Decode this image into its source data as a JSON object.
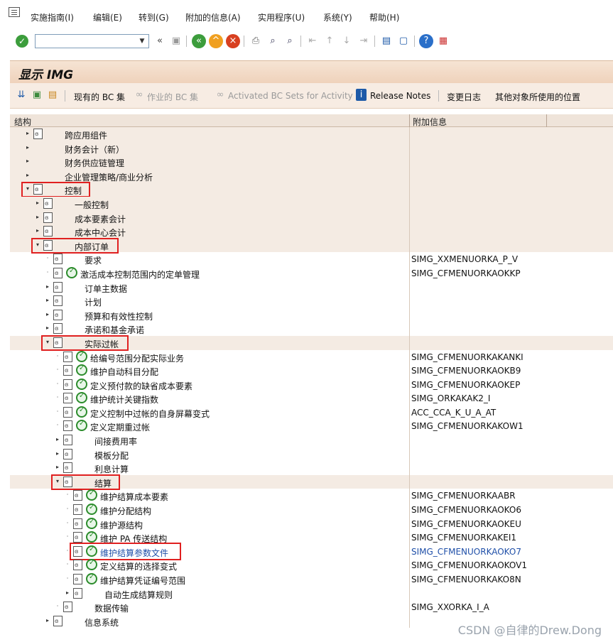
{
  "menu": {
    "items": [
      {
        "label": "实施指南(I)"
      },
      {
        "label": "编辑(E)"
      },
      {
        "label": "转到(G)"
      },
      {
        "label": "附加的信息(A)"
      },
      {
        "label": "实用程序(U)"
      },
      {
        "label": "系统(Y)"
      },
      {
        "label": "帮助(H)"
      }
    ]
  },
  "toolbar": {
    "command_field_value": "",
    "icons": [
      "check-icon",
      "dropdown-icon",
      "back-arrows-icon",
      "save-icon",
      "back-icon",
      "exit-icon",
      "cancel-icon",
      "print-icon",
      "find-icon",
      "find-next-icon",
      "first-page-icon",
      "previous-page-icon",
      "next-page-icon",
      "last-page-icon",
      "create-session-icon",
      "shortcut-icon",
      "help-icon",
      "layout-icon"
    ]
  },
  "title": "显示 IMG",
  "app_toolbar": {
    "existing_bc_sets": "现有的 BC 集",
    "bc_sets_for_activity": "作业的 BC 集",
    "activated_bc_sets": "Activated BC Sets for Activity",
    "release_notes": "Release Notes",
    "change_log": "变更日志",
    "where_used": "其他对象所使用的位置"
  },
  "columns": {
    "structure": "结构",
    "additional_info": "附加信息"
  },
  "tree": [
    {
      "label": "跨应用组件",
      "info": "",
      "level": 0,
      "expand": "▸",
      "icon": "node",
      "exec": false,
      "beige": true
    },
    {
      "label": "财务会计（新）",
      "info": "",
      "level": 0,
      "expand": "▸",
      "icon": "none",
      "exec": false,
      "beige": true
    },
    {
      "label": "财务供应链管理",
      "info": "",
      "level": 0,
      "expand": "▸",
      "icon": "none",
      "exec": false,
      "beige": true
    },
    {
      "label": "企业管理策略/商业分析",
      "info": "",
      "level": 0,
      "expand": "▸",
      "icon": "none",
      "exec": false,
      "beige": true
    },
    {
      "label": "控制",
      "info": "",
      "level": 0,
      "expand": "▾",
      "icon": "node",
      "exec": false,
      "beige": true,
      "highlight": true
    },
    {
      "label": "一般控制",
      "info": "",
      "level": 1,
      "expand": "▸",
      "icon": "node",
      "exec": false,
      "beige": true
    },
    {
      "label": "成本要素会计",
      "info": "",
      "level": 1,
      "expand": "▸",
      "icon": "node",
      "exec": false,
      "beige": true
    },
    {
      "label": "成本中心会计",
      "info": "",
      "level": 1,
      "expand": "▸",
      "icon": "node",
      "exec": false,
      "beige": true
    },
    {
      "label": "内部订单",
      "info": "",
      "level": 1,
      "expand": "▾",
      "icon": "node",
      "exec": false,
      "beige": true,
      "highlight": true
    },
    {
      "label": "要求",
      "info": "SIMG_XXMENUORKA_P_V",
      "level": 2,
      "expand": "·",
      "icon": "node",
      "exec": false,
      "beige": false
    },
    {
      "label": "激活成本控制范围内的定单管理",
      "info": "SIMG_CFMENUORKAOKKP",
      "level": 2,
      "expand": "·",
      "icon": "node",
      "exec": true,
      "beige": false
    },
    {
      "label": "订单主数据",
      "info": "",
      "level": 2,
      "expand": "▸",
      "icon": "node",
      "exec": false,
      "beige": false
    },
    {
      "label": "计划",
      "info": "",
      "level": 2,
      "expand": "▸",
      "icon": "node",
      "exec": false,
      "beige": false
    },
    {
      "label": "预算和有效性控制",
      "info": "",
      "level": 2,
      "expand": "▸",
      "icon": "node",
      "exec": false,
      "beige": false
    },
    {
      "label": "承诺和基金承诺",
      "info": "",
      "level": 2,
      "expand": "▸",
      "icon": "node",
      "exec": false,
      "beige": false
    },
    {
      "label": "实际过帐",
      "info": "",
      "level": 2,
      "expand": "▾",
      "icon": "node",
      "exec": false,
      "beige": true,
      "highlight": true
    },
    {
      "label": "给编号范围分配实际业务",
      "info": "SIMG_CFMENUORKAKANKI",
      "level": 3,
      "expand": "·",
      "icon": "node",
      "exec": true,
      "beige": false
    },
    {
      "label": "维护自动科目分配",
      "info": "SIMG_CFMENUORKAOKB9",
      "level": 3,
      "expand": "·",
      "icon": "node",
      "exec": true,
      "beige": false
    },
    {
      "label": "定义预付款的缺省成本要素",
      "info": "SIMG_CFMENUORKAOKEP",
      "level": 3,
      "expand": "·",
      "icon": "node",
      "exec": true,
      "beige": false
    },
    {
      "label": "维护统计关键指数",
      "info": "SIMG_ORKAKAK2_I",
      "level": 3,
      "expand": "·",
      "icon": "node",
      "exec": true,
      "beige": false
    },
    {
      "label": "定义控制中过帐的自身屏幕变式",
      "info": "ACC_CCA_K_U_A_AT",
      "level": 3,
      "expand": "·",
      "icon": "node",
      "exec": true,
      "beige": false
    },
    {
      "label": "定义定期重过帐",
      "info": "SIMG_CFMENUORKAKOW1",
      "level": 3,
      "expand": "·",
      "icon": "node",
      "exec": true,
      "beige": false
    },
    {
      "label": "间接费用率",
      "info": "",
      "level": 3,
      "expand": "▸",
      "icon": "node",
      "exec": false,
      "beige": false
    },
    {
      "label": "模板分配",
      "info": "",
      "level": 3,
      "expand": "▸",
      "icon": "node",
      "exec": false,
      "beige": false
    },
    {
      "label": "利息计算",
      "info": "",
      "level": 3,
      "expand": "▸",
      "icon": "node",
      "exec": false,
      "beige": false
    },
    {
      "label": "结算",
      "info": "",
      "level": 3,
      "expand": "▾",
      "icon": "node",
      "exec": false,
      "beige": true,
      "highlight": true
    },
    {
      "label": "维护结算成本要素",
      "info": "SIMG_CFMENUORKAABR",
      "level": 4,
      "expand": "·",
      "icon": "node",
      "exec": true,
      "beige": false
    },
    {
      "label": "维护分配结构",
      "info": "SIMG_CFMENUORKAOKO6",
      "level": 4,
      "expand": "·",
      "icon": "node",
      "exec": true,
      "beige": false
    },
    {
      "label": "维护源结构",
      "info": "SIMG_CFMENUORKAOKEU",
      "level": 4,
      "expand": "·",
      "icon": "node",
      "exec": true,
      "beige": false
    },
    {
      "label": "维护 PA 传送结构",
      "info": "SIMG_CFMENUORKAKEI1",
      "level": 4,
      "expand": "·",
      "icon": "node",
      "exec": true,
      "beige": false
    },
    {
      "label": "维护结算参数文件",
      "info": "SIMG_CFMENUORKAOKO7",
      "level": 4,
      "expand": "·",
      "icon": "node",
      "exec": true,
      "beige": false,
      "highlight": true,
      "link": true
    },
    {
      "label": "定义结算的选择变式",
      "info": "SIMG_CFMENUORKAOKOV1",
      "level": 4,
      "expand": "·",
      "icon": "node",
      "exec": true,
      "beige": false
    },
    {
      "label": "维护结算凭证编号范围",
      "info": "SIMG_CFMENUORKAKO8N",
      "level": 4,
      "expand": "·",
      "icon": "node",
      "exec": true,
      "beige": false
    },
    {
      "label": "自动生成结算规则",
      "info": "",
      "level": 4,
      "expand": "▸",
      "icon": "node",
      "exec": false,
      "beige": false
    },
    {
      "label": "数据传输",
      "info": "SIMG_XXORKA_I_A",
      "level": 3,
      "expand": "·",
      "icon": "node",
      "exec": false,
      "beige": false
    },
    {
      "label": "信息系统",
      "info": "",
      "level": 2,
      "expand": "▸",
      "icon": "node",
      "exec": false,
      "beige": false
    }
  ],
  "watermark": "CSDN @自律的Drew.Dong"
}
